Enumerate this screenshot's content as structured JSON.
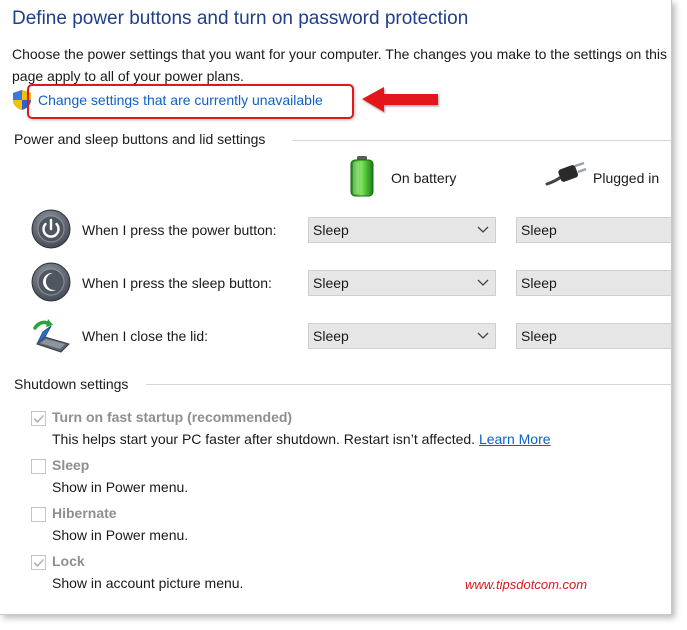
{
  "page": {
    "title": "Define power buttons and turn on password protection",
    "intro_line1": "Choose the power settings that you want for your computer. The changes you make to the settings on this",
    "intro_line2": "page apply to all of your power plans.",
    "change_link": "Change settings that are currently unavailable"
  },
  "power_section": {
    "heading": "Power and sleep buttons and lid settings",
    "col_battery": "On battery",
    "col_plugged": "Plugged in",
    "rows": [
      {
        "label": "When I press the power button:",
        "battery": "Sleep",
        "plugged": "Sleep"
      },
      {
        "label": "When I press the sleep button:",
        "battery": "Sleep",
        "plugged": "Sleep"
      },
      {
        "label": "When I close the lid:",
        "battery": "Sleep",
        "plugged": "Sleep"
      }
    ]
  },
  "shutdown_section": {
    "heading": "Shutdown settings",
    "items": [
      {
        "title": "Turn on fast startup (recommended)",
        "desc": "This helps start your PC faster after shutdown. Restart isn’t affected.",
        "link": "Learn More",
        "checked": true
      },
      {
        "title": "Sleep",
        "desc": "Show in Power menu.",
        "checked": false
      },
      {
        "title": "Hibernate",
        "desc": "Show in Power menu.",
        "checked": false
      },
      {
        "title": "Lock",
        "desc": "Show in account picture menu.",
        "checked": true
      }
    ]
  },
  "watermark": "www.tipsdotcom.com",
  "icons": {
    "shield": "uac-shield-icon",
    "battery": "battery-icon",
    "plug": "plug-icon",
    "power": "power-button-icon",
    "sleep": "sleep-button-icon",
    "lid": "laptop-lid-icon",
    "arrow": "red-arrow-icon",
    "dropdown": "chevron-down-icon",
    "check": "checkmark-icon"
  },
  "colors": {
    "title": "#1e3f8a",
    "link": "#0b62c9",
    "highlight": "#e3161b",
    "watermark": "#d81b1b",
    "select_bg": "#e6e6e6"
  }
}
